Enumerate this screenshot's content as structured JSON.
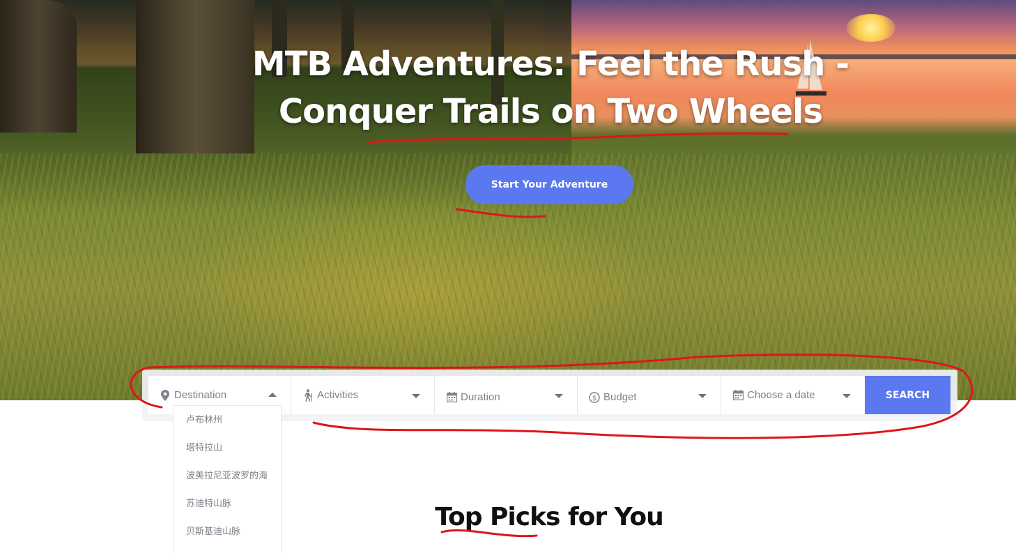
{
  "hero": {
    "title_line1": "MTB Adventures: Feel the Rush -",
    "title_line2": "Conquer Trails on Two Wheels",
    "cta_label": "Start Your Adventure"
  },
  "search": {
    "destination": {
      "label": "Destination",
      "icon": "map-pin-icon",
      "open": true
    },
    "activities": {
      "label": "Activities",
      "icon": "hiking-icon"
    },
    "duration": {
      "label": "Duration",
      "icon": "calendar-icon"
    },
    "budget": {
      "label": "Budget",
      "icon": "dollar-circle-icon"
    },
    "date": {
      "label": "Choose a date",
      "icon": "calendar-icon"
    },
    "button_label": "SEARCH"
  },
  "destination_options": [
    "卢布林州",
    "塔特拉山",
    "波美拉尼亚波罗的海",
    "苏迪特山脉",
    "贝斯基迪山脉"
  ],
  "section": {
    "title": "Top Picks for You"
  },
  "colors": {
    "accent": "#5b78f0",
    "annotation": "#e0141c"
  }
}
